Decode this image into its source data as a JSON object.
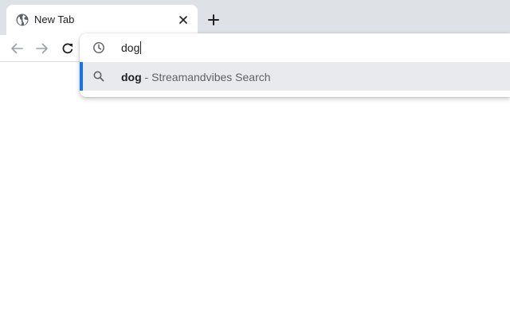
{
  "tab": {
    "title": "New Tab",
    "favicon": "globe-icon",
    "close_icon": "close-icon"
  },
  "new_tab_icon": "plus-icon",
  "toolbar": {
    "back_icon": "arrow-left-icon",
    "forward_icon": "arrow-right-icon",
    "reload_icon": "reload-icon"
  },
  "omnibox": {
    "value": "dog",
    "input_icon": "history-icon",
    "suggestions": [
      {
        "icon": "search-icon",
        "query": "dog",
        "separator": " - ",
        "engine": "Streamandvibes Search",
        "selected": true
      }
    ]
  },
  "colors": {
    "tabstrip": "#dee1e6",
    "selected_suggestion": "#e8eaed",
    "accent": "#1a73e8"
  }
}
